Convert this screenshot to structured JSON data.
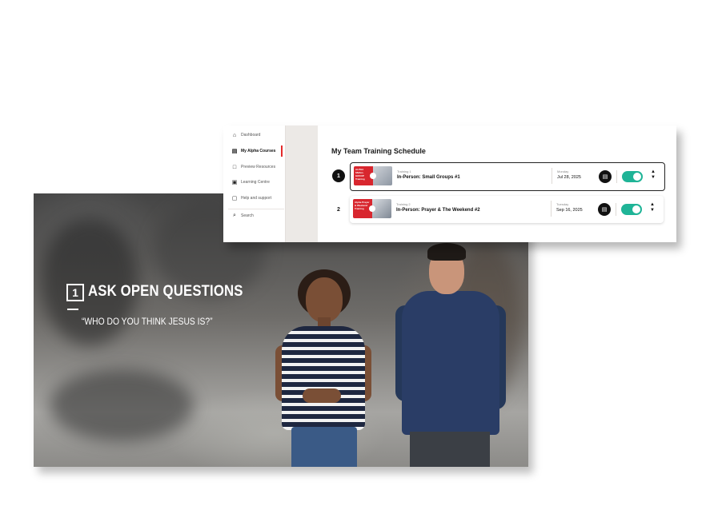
{
  "video": {
    "step_number": "1",
    "title": "ASK OPEN QUESTIONS",
    "quote": "“WHO DO YOU THINK JESUS IS?”"
  },
  "sidebar": {
    "items": [
      {
        "label": "Dashboard",
        "icon": "home-icon",
        "glyph": "⌂",
        "active": false
      },
      {
        "label": "My Alpha Courses",
        "icon": "courses-icon",
        "glyph": "▤",
        "active": true
      },
      {
        "label": "Preview Resources",
        "icon": "monitor-icon",
        "glyph": "□",
        "active": false
      },
      {
        "label": "Learning Centre",
        "icon": "book-icon",
        "glyph": "▣",
        "active": false
      },
      {
        "label": "Help and support",
        "icon": "help-icon",
        "glyph": "▢",
        "active": false
      },
      {
        "label": "Search",
        "icon": "search-icon",
        "glyph": "⌕",
        "active": false
      }
    ]
  },
  "main": {
    "heading": "My Team Training Schedule",
    "trainings": [
      {
        "index": "1",
        "label": "Training 1",
        "title": "In-Person: Small Groups #1",
        "day": "Monday",
        "date": "Jul 28, 2025",
        "enabled": true,
        "thumb_text": "ALPHA SMALL GROUP Training"
      },
      {
        "index": "2",
        "label": "Training 2",
        "title": "In-Person: Prayer & The Weekend #2",
        "day": "Tuesday",
        "date": "Sep 16, 2025",
        "enabled": true,
        "thumb_text": "Alpha Prayer & Weekend Training"
      }
    ]
  },
  "colors": {
    "accent_red": "#e42a2a",
    "toggle_green": "#1fb497",
    "gutter": "#ece9e6"
  }
}
